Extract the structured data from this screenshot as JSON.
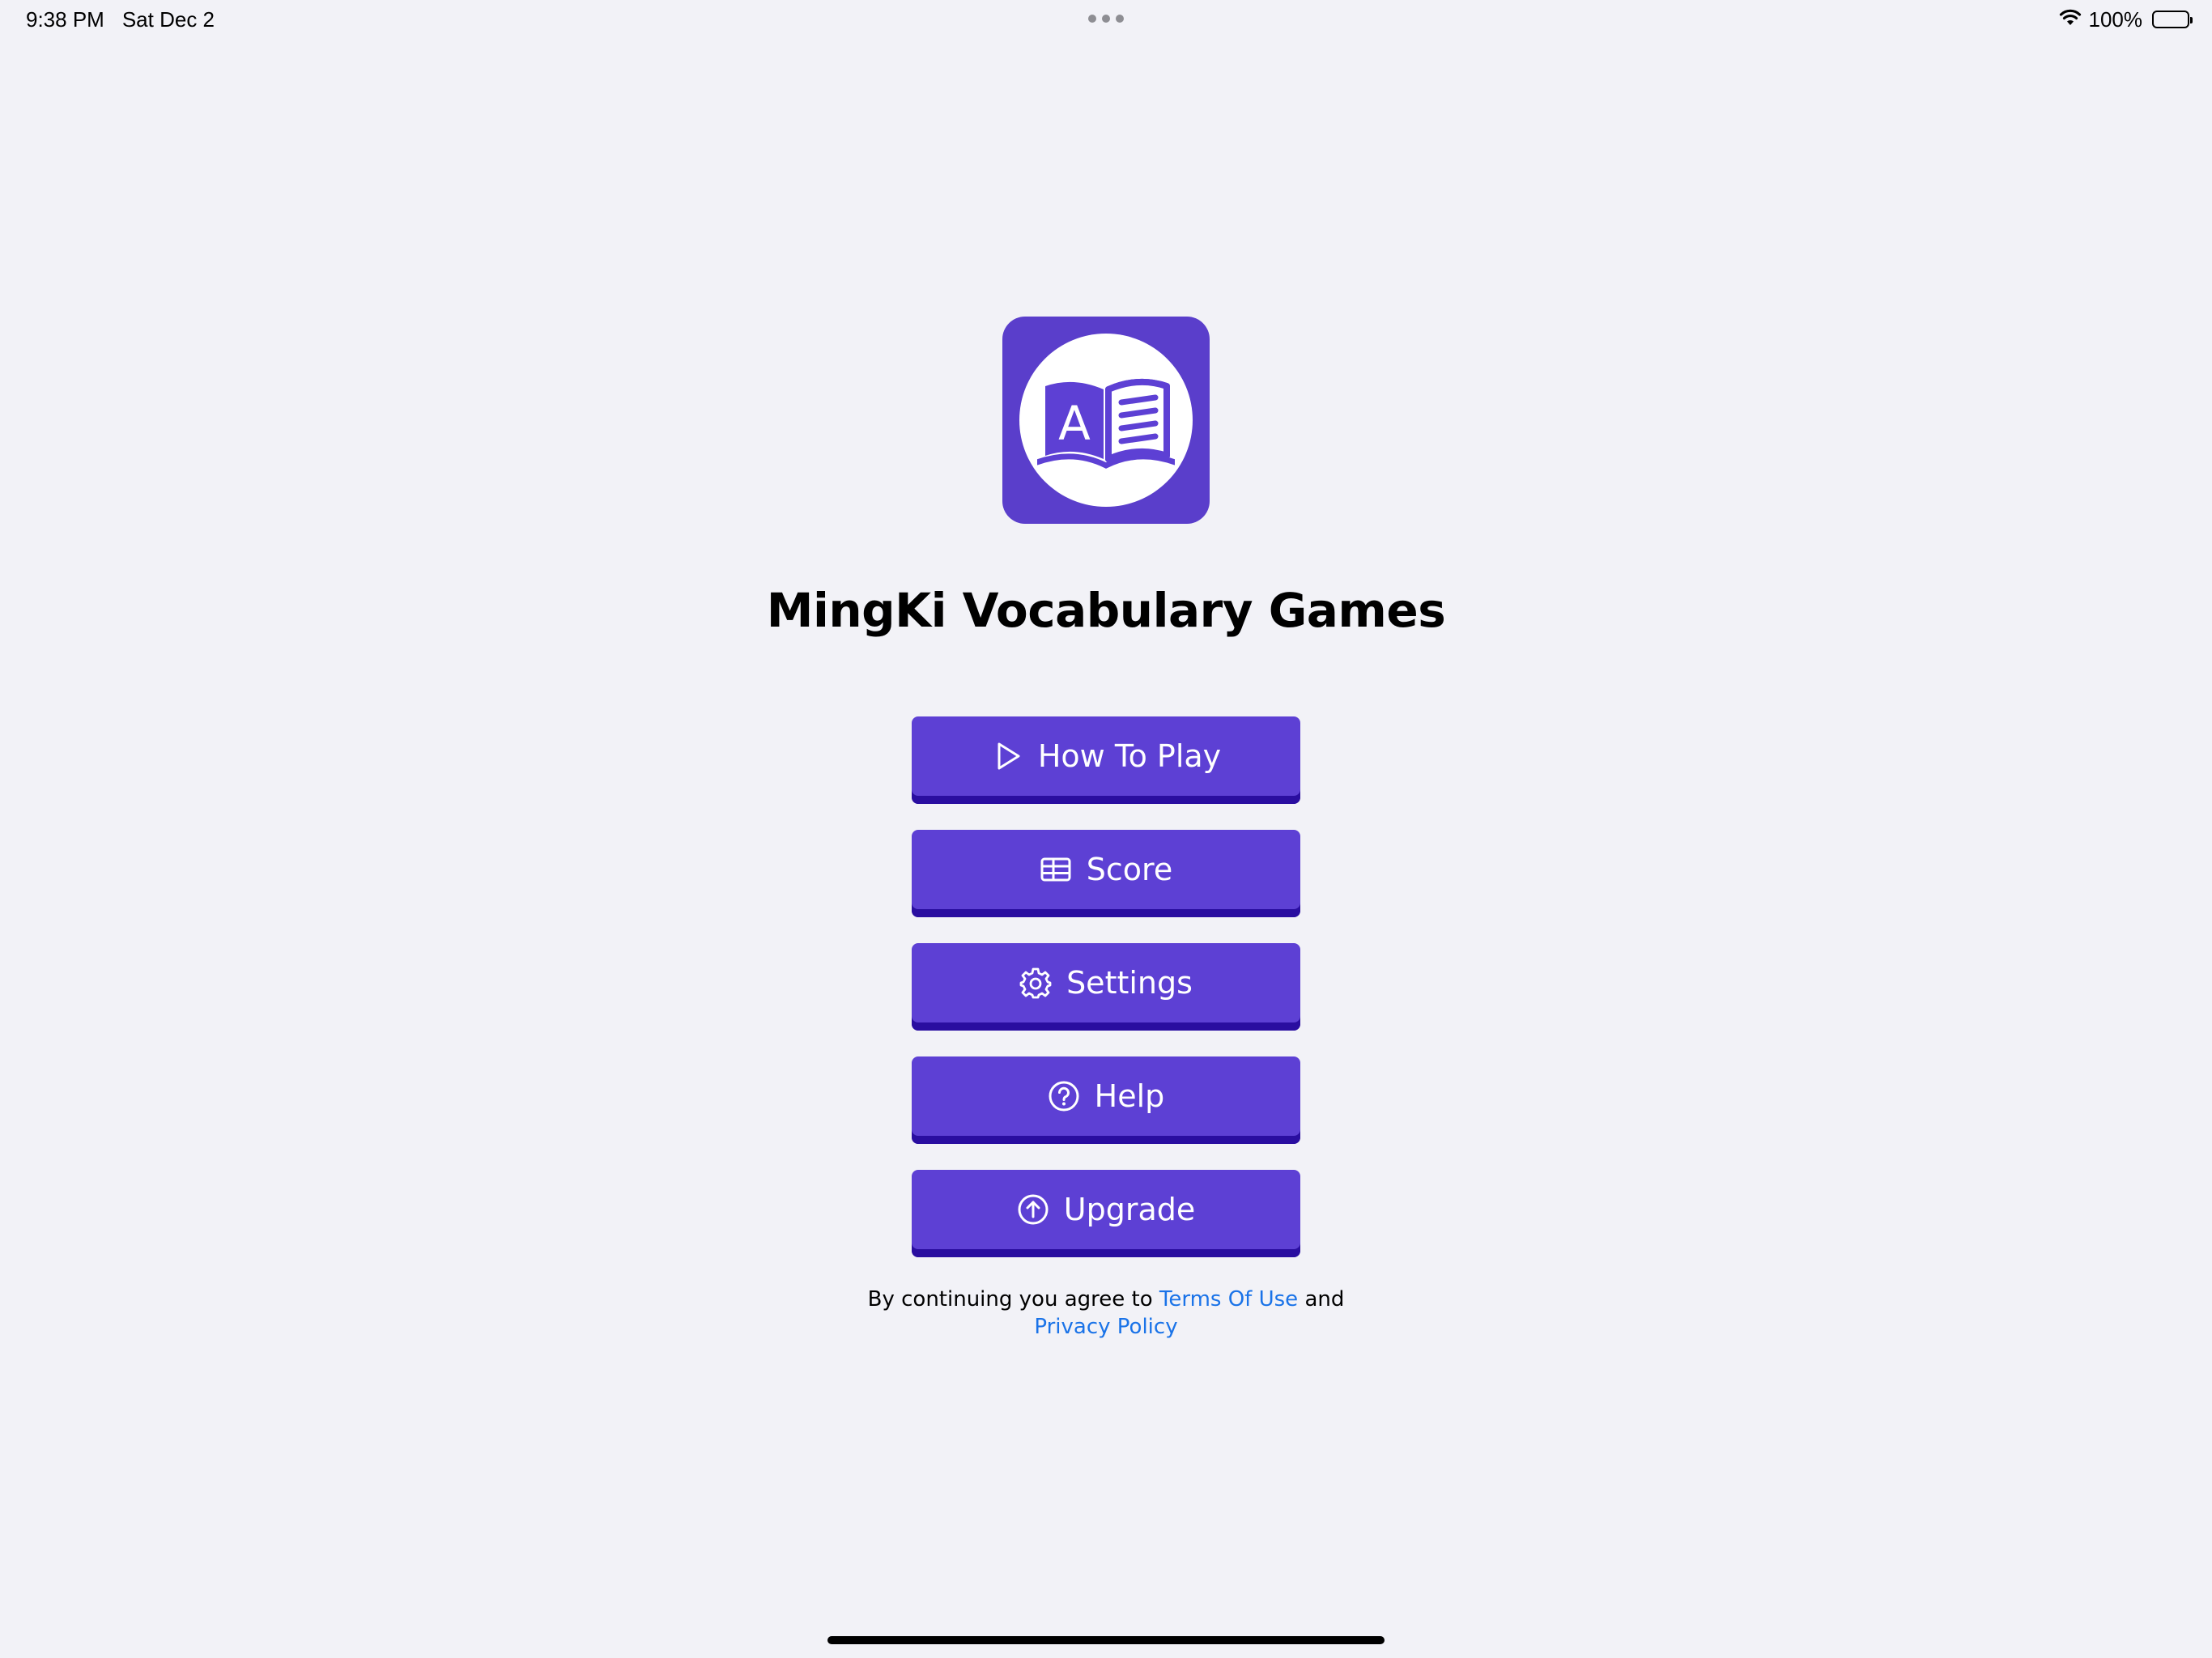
{
  "status_bar": {
    "time": "9:38 PM",
    "date": "Sat Dec 2",
    "battery": "100%",
    "icons": [
      "wifi-icon",
      "battery-icon"
    ]
  },
  "app": {
    "logo_letter": "A",
    "title": "MingKi Vocabulary Games",
    "brand_color": "#5d40d4",
    "brand_shadow_color": "#2a0ea0"
  },
  "menu": {
    "items": [
      {
        "label": "How To Play",
        "icon": "play-icon"
      },
      {
        "label": "Score",
        "icon": "table-icon"
      },
      {
        "label": "Settings",
        "icon": "gear-icon"
      },
      {
        "label": "Help",
        "icon": "question-circle-icon"
      },
      {
        "label": "Upgrade",
        "icon": "arrow-up-circle-icon"
      }
    ]
  },
  "legal": {
    "prefix": "By continuing you agree to",
    "terms_link": "Terms Of Use",
    "connector": "and",
    "privacy_link": "Privacy Policy",
    "link_color": "#1a73e8"
  }
}
